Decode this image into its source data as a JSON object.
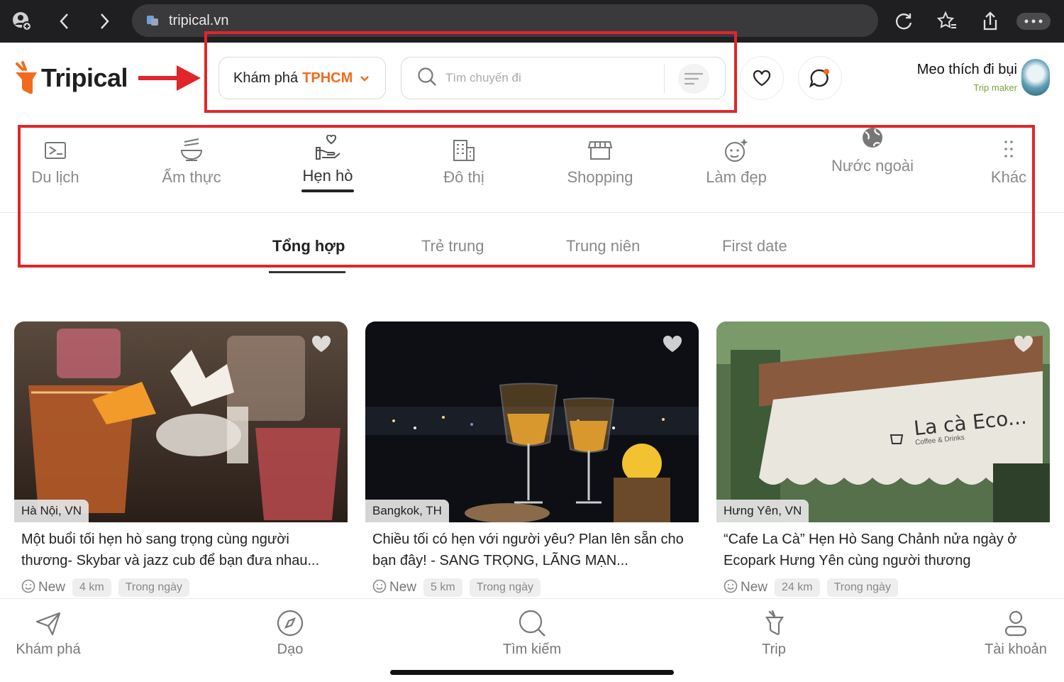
{
  "browser": {
    "url": "tripical.vn"
  },
  "header": {
    "logo_text": "Tripical",
    "explore_label": "Khám phá",
    "explore_city": "TPHCM",
    "search_placeholder": "Tìm chuyến đi",
    "user_name": "Meo thích đi bụi",
    "user_role": "Trip maker"
  },
  "categories": [
    {
      "label": "Du lịch",
      "icon": "luggage-icon"
    },
    {
      "label": "Ẩm thực",
      "icon": "noodle-bowl-icon"
    },
    {
      "label": "Hẹn hò",
      "icon": "hand-heart-icon",
      "active": true
    },
    {
      "label": "Đô thị",
      "icon": "building-icon"
    },
    {
      "label": "Shopping",
      "icon": "store-icon"
    },
    {
      "label": "Làm đẹp",
      "icon": "face-sparkle-icon"
    },
    {
      "label": "Nước ngoài",
      "icon": "globe-icon"
    },
    {
      "label": "Khác",
      "icon": "dots-grid-icon"
    }
  ],
  "subtabs": [
    "Tổng hợp",
    "Trẻ trung",
    "Trung niên",
    "First date"
  ],
  "cards": [
    {
      "location": "Hà Nội, VN",
      "title": "Một buổi tối hẹn hò sang trọng cùng người thương- Skybar và jazz cub để bạn đưa nhau...",
      "status": "New",
      "distance": "4 km",
      "duration": "Trong ngày"
    },
    {
      "location": "Bangkok, TH",
      "title": "Chiều tối có hẹn với người yêu? Plan lên sẵn cho bạn đây! - SANG TRỌNG, LÃNG MẠN...",
      "status": "New",
      "distance": "5 km",
      "duration": "Trong ngày"
    },
    {
      "location": "Hưng Yên, VN",
      "title": "“Cafe La Cà” Hẹn Hò Sang Chảnh nửa ngày ở Ecopark Hưng Yên cùng người thương",
      "status": "New",
      "distance": "24 km",
      "duration": "Trong ngày",
      "sign_text": "La cà Eco...",
      "sign_subtext": "Coffee & Drinks"
    }
  ],
  "bottom_nav": [
    {
      "label": "Khám phá",
      "icon": "paper-plane-icon"
    },
    {
      "label": "Dạo",
      "icon": "compass-icon"
    },
    {
      "label": "Tìm kiếm",
      "icon": "search-icon"
    },
    {
      "label": "Trip",
      "icon": "trip-icon"
    },
    {
      "label": "Tài khoản",
      "icon": "person-icon"
    }
  ],
  "colors": {
    "accent": "#f26b1d",
    "annotation_red": "#e0262b",
    "positive": "#7aa33d"
  }
}
